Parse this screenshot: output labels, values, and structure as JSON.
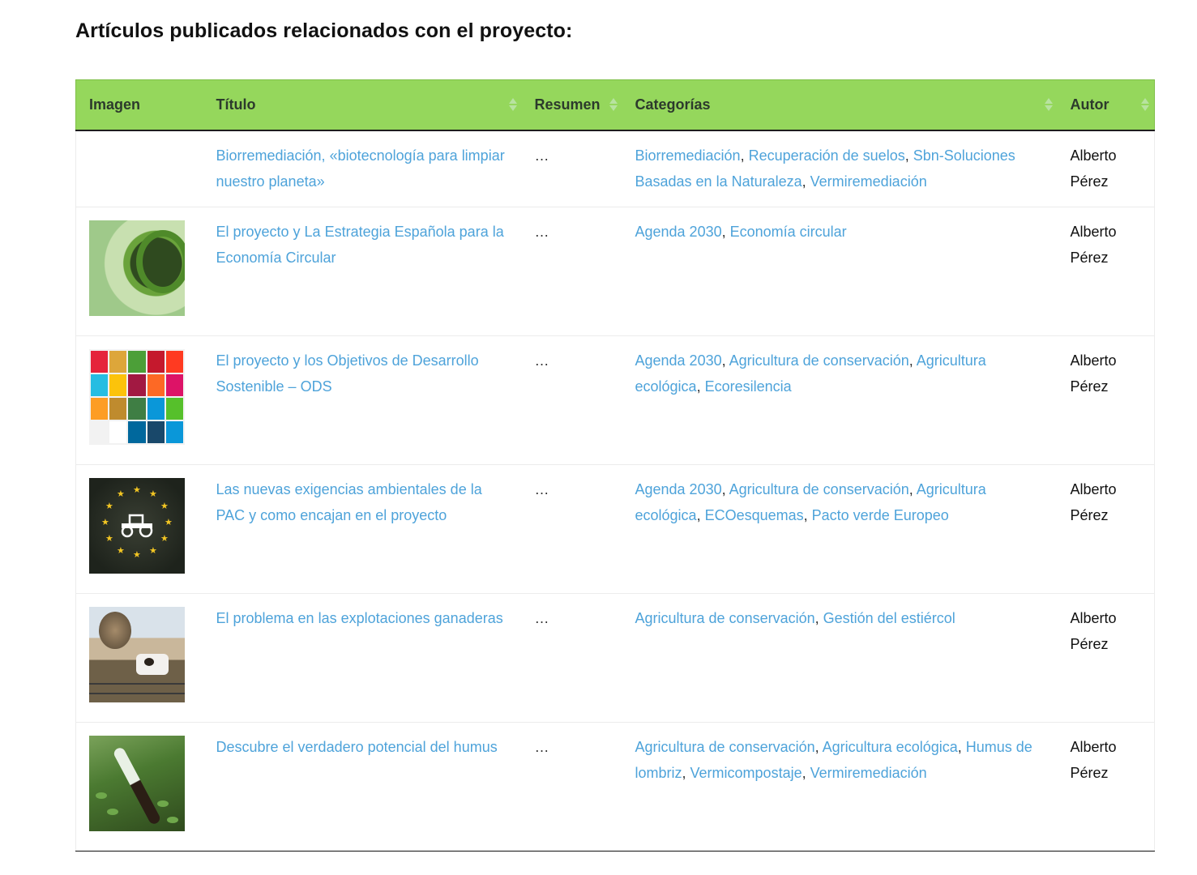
{
  "heading": "Artículos publicados relacionados con el proyecto:",
  "colors": {
    "header_bg": "#95d75c",
    "link": "#4ea3da",
    "text": "#111111"
  },
  "table": {
    "columns": [
      {
        "label": "Imagen",
        "sortable": false
      },
      {
        "label": "Título",
        "sortable": true
      },
      {
        "label": "Resumen",
        "sortable": true
      },
      {
        "label": "Categorías",
        "sortable": true
      },
      {
        "label": "Autor",
        "sortable": true
      }
    ],
    "rows": [
      {
        "image": "",
        "title": "Biorremediación, «biotecnología para limpiar nuestro planeta»",
        "summary": "…",
        "categories": [
          "Biorremediación",
          "Recuperación de suelos",
          "Sbn-Soluciones Basadas en la Naturaleza",
          "Vermiremediación"
        ],
        "author": "Alberto Pérez"
      },
      {
        "image": "economia-circular-thumbnail",
        "title": "El proyecto y La Estrategia Española para la Economía Circular",
        "summary": "…",
        "categories": [
          "Agenda 2030",
          "Economía circular"
        ],
        "author": "Alberto Pérez"
      },
      {
        "image": "ods-grid-thumbnail",
        "title": "El proyecto y los Objetivos de Desarrollo Sostenible – ODS",
        "summary": "…",
        "categories": [
          "Agenda 2030",
          "Agricultura de conservación",
          "Agricultura ecológica",
          "Ecoresilencia"
        ],
        "author": "Alberto Pérez"
      },
      {
        "image": "eu-tractor-thumbnail",
        "title": "Las nuevas exigencias ambientales de la PAC y como encajan en el proyecto",
        "summary": "…",
        "categories": [
          "Agenda 2030",
          "Agricultura de conservación",
          "Agricultura ecológica",
          "ECOesquemas",
          "Pacto verde Europeo"
        ],
        "author": "Alberto Pérez"
      },
      {
        "image": "cow-farm-thumbnail",
        "title": "El problema en las explotaciones ganaderas",
        "summary": "…",
        "categories": [
          "Agricultura de conservación",
          "Gestión del estiércol"
        ],
        "author": "Alberto Pérez"
      },
      {
        "image": "humus-tube-thumbnail",
        "title": "Descubre el verdadero potencial del humus",
        "summary": "…",
        "categories": [
          "Agricultura de conservación",
          "Agricultura ecológica",
          "Humus de lombriz",
          "Vermicompostaje",
          "Vermiremediación"
        ],
        "author": "Alberto Pérez"
      }
    ]
  }
}
